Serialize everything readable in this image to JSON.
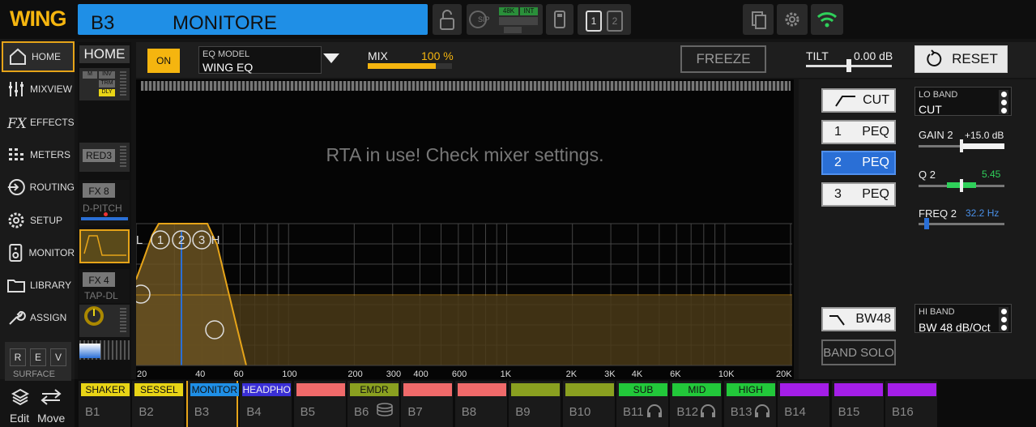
{
  "app": {
    "logo": "WING",
    "channel_id": "B3",
    "channel_name": "MONITORE"
  },
  "topbar": {
    "sip": "SIP",
    "badge_48k": "48K",
    "badge_int": "INT",
    "page1": "1",
    "page2": "2",
    "colors": {
      "accent": "#f5b50f",
      "channel": "#1f8fe6",
      "wifi": "#2fd05a"
    },
    "icons": [
      "lock-icon",
      "usb-icon",
      "copy-icon",
      "gear-icon",
      "wifi-icon"
    ]
  },
  "sidebar": {
    "items": [
      {
        "label": "HOME",
        "icon": "home-icon"
      },
      {
        "label": "MIXVIEW",
        "icon": "sliders-icon"
      },
      {
        "label": "EFFECTS",
        "icon": "fx-icon"
      },
      {
        "label": "METERS",
        "icon": "meters-icon"
      },
      {
        "label": "ROUTING",
        "icon": "routing-icon"
      },
      {
        "label": "SETUP",
        "icon": "gear-icon"
      },
      {
        "label": "MONITOR",
        "icon": "speaker-icon"
      },
      {
        "label": "LIBRARY",
        "icon": "folder-icon"
      },
      {
        "label": "ASSIGN",
        "icon": "wrench-icon"
      }
    ],
    "surface": {
      "r": "R",
      "e": "E",
      "v": "V",
      "label": "SURFACE"
    },
    "edit": "Edit",
    "move": "Move"
  },
  "strip": {
    "home": "HOME",
    "m": "M",
    "inv": "INV",
    "trm": "TRM",
    "dly": "DLY",
    "red3": "RED3",
    "fx8": "FX 8",
    "fx8_name": "D-PITCH",
    "fx4": "FX 4",
    "fx4_name": "TAP-DL"
  },
  "eqbar": {
    "on": "ON",
    "model_label": "EQ MODEL",
    "model_value": "WING EQ",
    "mix_label": "MIX",
    "mix_value": "100 %",
    "mix_level": 1.0,
    "freeze": "FREEZE",
    "tilt_label": "TILT",
    "tilt_value": "0.00 dB",
    "reset": "RESET"
  },
  "eq": {
    "rta_msg": "RTA in use! Check mixer settings.",
    "markers": [
      "L",
      "1",
      "2",
      "3",
      "H"
    ],
    "freq_ticks": [
      "20",
      "40",
      "60",
      "100",
      "200",
      "300",
      "400",
      "600",
      "1K",
      "2K",
      "3K",
      "4K",
      "6K",
      "10K",
      "20K"
    ]
  },
  "right": {
    "bands": [
      {
        "num": "",
        "label": "CUT",
        "icon": "lowcut-icon"
      },
      {
        "num": "1",
        "label": "PEQ"
      },
      {
        "num": "2",
        "label": "PEQ",
        "selected": true
      },
      {
        "num": "3",
        "label": "PEQ"
      }
    ],
    "lo_band": {
      "label": "LO BAND",
      "value": "CUT"
    },
    "gain": {
      "label": "GAIN 2",
      "value": "+15.0 dB"
    },
    "q": {
      "label": "Q 2",
      "value": "5.45"
    },
    "freq": {
      "label": "FREQ 2",
      "value": "32.2 Hz"
    },
    "hi_btn": {
      "label": "BW48"
    },
    "hi_band": {
      "label": "HI BAND",
      "value": "BW 48 dB/Oct"
    },
    "band_solo": "BAND SOLO"
  },
  "channels": [
    {
      "tag": "SHAKER",
      "id": "B1",
      "color": "#e8d416"
    },
    {
      "tag": "SESSEL",
      "id": "B2",
      "color": "#e8d416"
    },
    {
      "tag": "MONITOR",
      "id": "B3",
      "color": "#1f8fe6"
    },
    {
      "tag": "HEADPHO",
      "id": "B4",
      "color": "#3a2fd6"
    },
    {
      "tag": "",
      "id": "B5",
      "color": "#f06a6a"
    },
    {
      "tag": "EMDR",
      "id": "B6",
      "color": "#8aa020"
    },
    {
      "tag": "",
      "id": "B7",
      "color": "#f06a6a"
    },
    {
      "tag": "",
      "id": "B8",
      "color": "#f06a6a"
    },
    {
      "tag": "",
      "id": "B9",
      "color": "#8aa020"
    },
    {
      "tag": "",
      "id": "B10",
      "color": "#8aa020"
    },
    {
      "tag": "SUB",
      "id": "B11",
      "color": "#22c83a"
    },
    {
      "tag": "MID",
      "id": "B12",
      "color": "#22c83a"
    },
    {
      "tag": "HIGH",
      "id": "B13",
      "color": "#22c83a"
    },
    {
      "tag": "",
      "id": "B14",
      "color": "#a41ee8"
    },
    {
      "tag": "",
      "id": "B15",
      "color": "#a41ee8"
    },
    {
      "tag": "",
      "id": "B16",
      "color": "#a41ee8"
    }
  ]
}
